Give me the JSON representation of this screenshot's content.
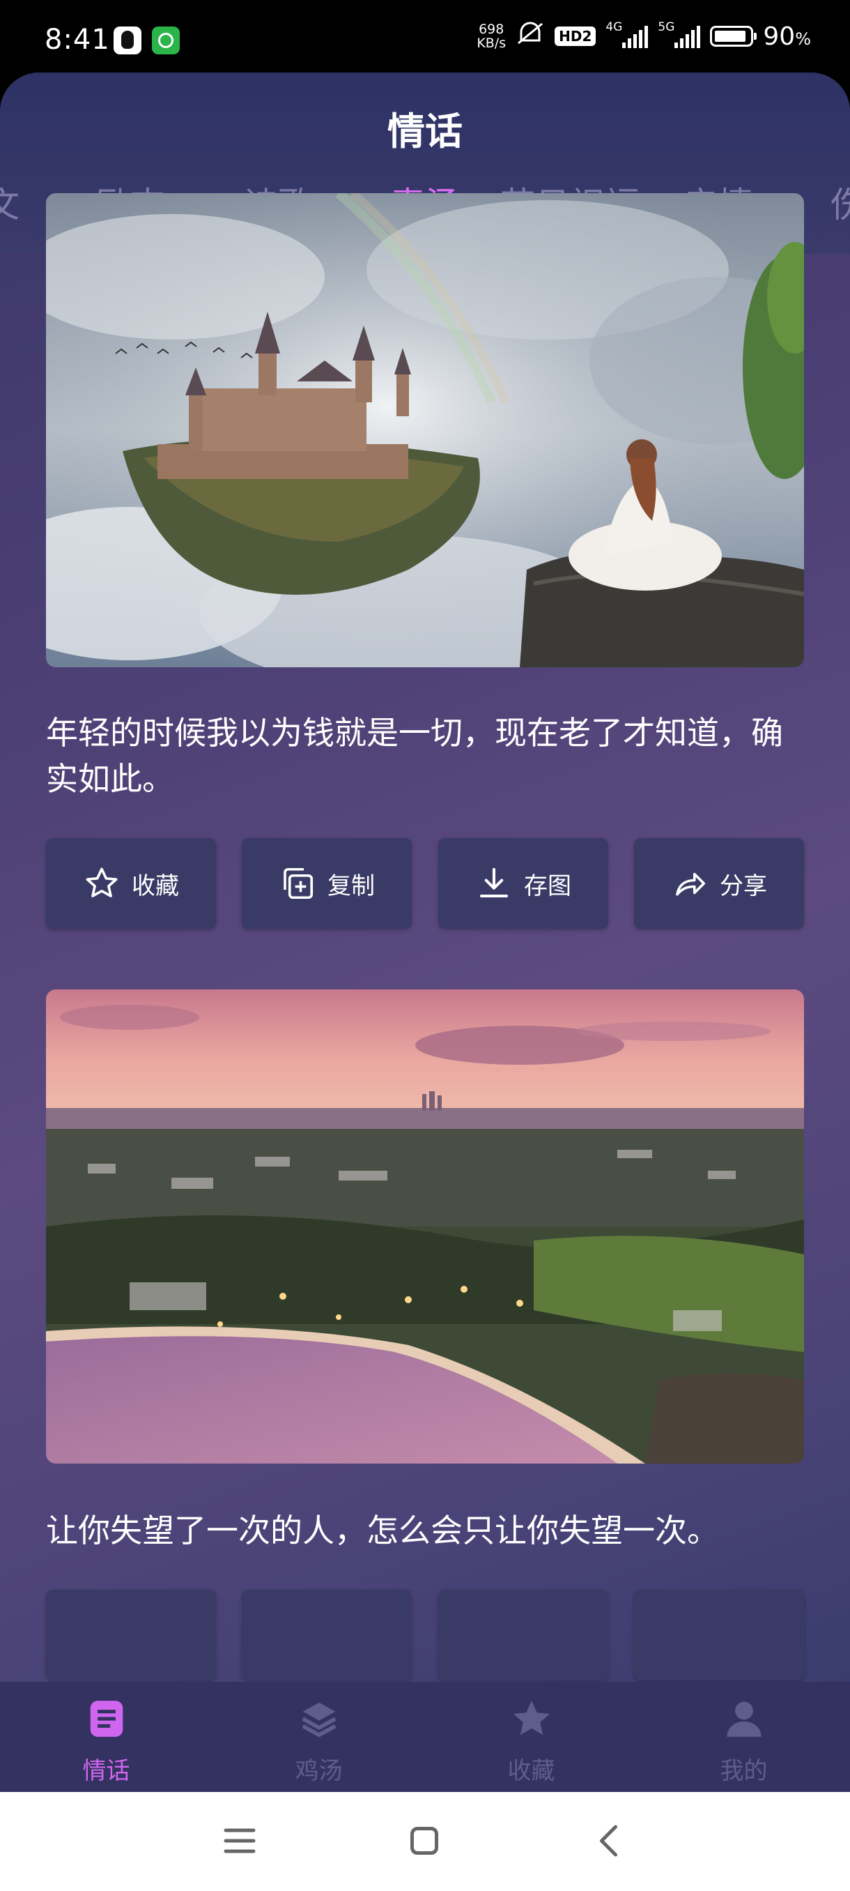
{
  "status_bar": {
    "time": "8:41",
    "speed_value": "698",
    "speed_unit": "KB/s",
    "hd_badge": "HD2",
    "net1": "4G",
    "net2": "5G",
    "battery_pct": "90",
    "battery_unit": "%"
  },
  "app": {
    "title": "情话",
    "tabs": [
      {
        "label": "文"
      },
      {
        "label": "励志"
      },
      {
        "label": "诗歌"
      },
      {
        "label": "毒汤",
        "active": true
      },
      {
        "label": "节日祝福"
      },
      {
        "label": "亲情"
      },
      {
        "label": "伤"
      }
    ]
  },
  "cards": [
    {
      "image": "fantasy-castle-on-clouds-with-woman",
      "text": "年轻的时候我以为钱就是一切，现在老了才知道，确实如此。"
    },
    {
      "image": "coastal-town-at-sunset",
      "text": "让你失望了一次的人，怎么会只让你失望一次。"
    }
  ],
  "actions": {
    "favorite": "收藏",
    "copy": "复制",
    "save_image": "存图",
    "share": "分享"
  },
  "bottom_nav": [
    {
      "label": "情话",
      "icon": "list-icon",
      "active": true
    },
    {
      "label": "鸡汤",
      "icon": "layers-icon"
    },
    {
      "label": "收藏",
      "icon": "star-icon"
    },
    {
      "label": "我的",
      "icon": "person-icon"
    }
  ],
  "colors": {
    "accent": "#d066f0",
    "inactive": "#5e5d8c",
    "button_bg": "#3a3a66"
  }
}
